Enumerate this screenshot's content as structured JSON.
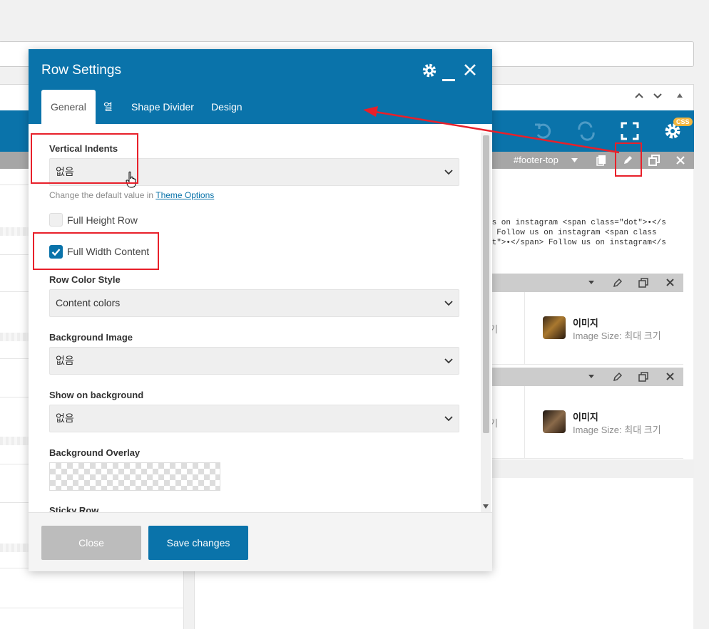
{
  "modal": {
    "title": "Row Settings",
    "tabs": [
      {
        "label": "General",
        "active": true
      },
      {
        "label": "열"
      },
      {
        "label": "Shape Divider"
      },
      {
        "label": "Design"
      }
    ],
    "fields": {
      "vertical_indents": {
        "label": "Vertical Indents",
        "value": "없음"
      },
      "help_text": "Change the default value in",
      "help_link": "Theme Options",
      "full_height_row": {
        "label": "Full Height Row",
        "checked": false
      },
      "full_width_content": {
        "label": "Full Width Content",
        "checked": true
      },
      "row_color_style": {
        "label": "Row Color Style",
        "value": "Content colors"
      },
      "background_image": {
        "label": "Background Image",
        "value": "없음"
      },
      "show_on_background": {
        "label": "Show on background",
        "value": "없음"
      },
      "background_overlay": {
        "label": "Background Overlay"
      },
      "sticky_row": {
        "label": "Sticky Row"
      }
    },
    "buttons": {
      "close": "Close",
      "save": "Save changes"
    }
  },
  "background": {
    "toolbar": {
      "css_badge": "CSS"
    },
    "row_bar": {
      "label": "#footer-top"
    },
    "code_lines": [
      "us on instagram <span class=\"dot\">•</s",
      "> Follow us on instagram <span class",
      "ot\">•</span> Follow us on instagram</s"
    ],
    "cells": [
      {
        "side_label": "기",
        "title": "이미지",
        "subtitle": "Image Size: 최대 크기"
      },
      {
        "side_label": "기",
        "title": "이미지",
        "subtitle": "Image Size: 최대 크기"
      }
    ]
  },
  "colors": {
    "primary": "#0a73aa",
    "annotation": "#e8202a"
  }
}
